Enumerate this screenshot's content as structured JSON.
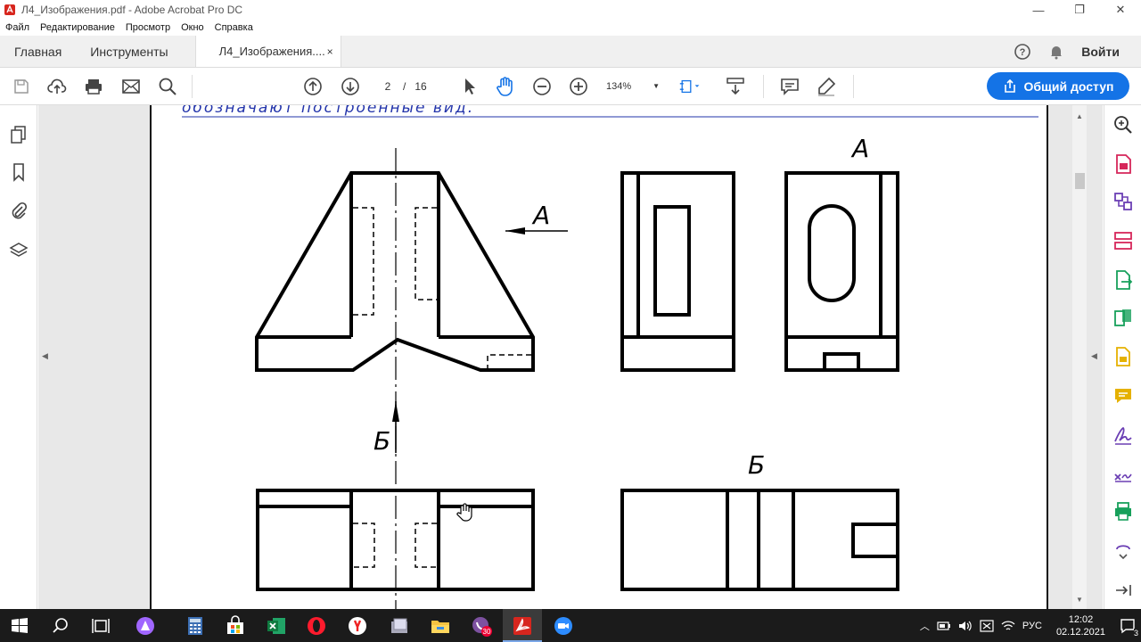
{
  "window": {
    "title": "Л4_Изображения.pdf - Adobe Acrobat Pro DC"
  },
  "menu": [
    "Файл",
    "Редактирование",
    "Просмотр",
    "Окно",
    "Справка"
  ],
  "tabs": {
    "home": "Главная",
    "tools": "Инструменты",
    "document": "Л4_Изображения....",
    "close": "×"
  },
  "account": {
    "signin": "Войти"
  },
  "toolbar": {
    "page_current": "2",
    "page_separator": "/",
    "page_total": "16",
    "zoom": "134%"
  },
  "share": {
    "label": "Общий доступ"
  },
  "drawing": {
    "top_heading": "обозначают построенные вид.",
    "label_view_a_arrow": "А",
    "label_view_a": "А",
    "label_view_b_arrow": "Б",
    "label_view_b": "Б"
  },
  "taskbar": {
    "viber_badge": "30",
    "lang": "РУС",
    "time": "12:02",
    "date": "02.12.2021",
    "notifications": "3"
  },
  "colors": {
    "accent": "#1473e6",
    "acrobat_red": "#d7261e",
    "tool_pink": "#d6265a",
    "tool_green": "#17a05b",
    "tool_yellow": "#e5b100",
    "tool_purple": "#6b3fb4",
    "heading_blue": "#2233aa"
  }
}
